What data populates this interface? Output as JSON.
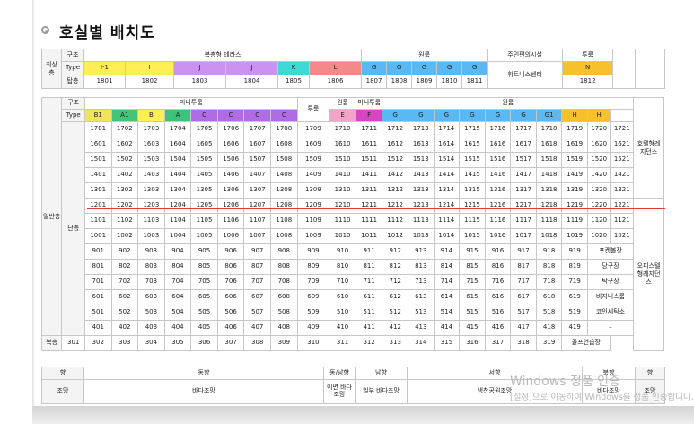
{
  "title": "호실별 배치도",
  "colors": {
    "I": "#ffee55",
    "J": "#c993ef",
    "K": "#3fd8d6",
    "L": "#f28a8a",
    "G": "#5ab8f2",
    "N": "#f7c02d",
    "B1": "#f2e45a",
    "A1": "#44c47b",
    "B": "#ffee55",
    "A": "#3cc27c",
    "C": "#b06ce2",
    "D": "#3aa7e8",
    "E": "#f2a5c8",
    "F": "#d845c0",
    "H": "#f7c02d"
  },
  "top": {
    "side_label": "최상층",
    "row_labels": [
      "구조",
      "Type",
      "탑층"
    ],
    "groups": {
      "bokcheung": "복층형 테라스",
      "wonroom": "원룸",
      "convenience": "주민편의시설",
      "tworoom": "투룸"
    },
    "types": [
      "I-1",
      "I",
      "J",
      "J",
      "K",
      "L",
      "G",
      "G",
      "G",
      "G",
      "G",
      "N"
    ],
    "type_keys": [
      "I",
      "I",
      "J",
      "J",
      "K",
      "L",
      "G",
      "G",
      "G",
      "G",
      "G",
      "N"
    ],
    "units": [
      "1801",
      "1802",
      "1803",
      "1804",
      "1805",
      "1806",
      "1807",
      "1808",
      "1809",
      "1810",
      "1811",
      "1812"
    ],
    "fitness": "휘트니스센터"
  },
  "main": {
    "side_label": "일반층",
    "side_label2": "단층",
    "row_labels": [
      "구조",
      "Type"
    ],
    "groups": {
      "mini": "미니투룸",
      "two": "투룸",
      "one": "원룸",
      "minitwo": "미니투룸",
      "wonroom": "원룸"
    },
    "types": [
      "B1",
      "A1",
      "B",
      "A",
      "C",
      "C",
      "C",
      "C",
      "D",
      "E",
      "F",
      "G",
      "G",
      "G",
      "G",
      "G",
      "G",
      "G1",
      "H",
      "H"
    ],
    "type_keys": [
      "B1",
      "A1",
      "B",
      "A",
      "C",
      "C",
      "C",
      "C",
      "D",
      "E",
      "F",
      "G",
      "G",
      "G",
      "G",
      "G",
      "G",
      "G",
      "H",
      "H"
    ],
    "right_labels": {
      "hotel": "호텔형레지던스",
      "office": "오피스텔형레지던스"
    },
    "rows": [
      [
        "1701",
        "1702",
        "1703",
        "1704",
        "1705",
        "1706",
        "1707",
        "1708",
        "1709",
        "1710",
        "1711",
        "1712",
        "1713",
        "1714",
        "1715",
        "1716",
        "1717",
        "1718",
        "1719",
        "1720",
        "1721"
      ],
      [
        "1601",
        "1602",
        "1603",
        "1604",
        "1605",
        "1606",
        "1607",
        "1608",
        "1609",
        "1610",
        "1611",
        "1612",
        "1613",
        "1614",
        "1615",
        "1616",
        "1617",
        "1618",
        "1619",
        "1620",
        "1621"
      ],
      [
        "1501",
        "1502",
        "1503",
        "1504",
        "1505",
        "1506",
        "1507",
        "1508",
        "1509",
        "1510",
        "1511",
        "1512",
        "1513",
        "1514",
        "1515",
        "1516",
        "1517",
        "1518",
        "1519",
        "1520",
        "1521"
      ],
      [
        "1401",
        "1402",
        "1403",
        "1404",
        "1405",
        "1406",
        "1407",
        "1408",
        "1409",
        "1410",
        "1411",
        "1412",
        "1413",
        "1414",
        "1415",
        "1416",
        "1417",
        "1418",
        "1419",
        "1420",
        "1421"
      ],
      [
        "1301",
        "1302",
        "1303",
        "1304",
        "1305",
        "1306",
        "1307",
        "1308",
        "1309",
        "1310",
        "1311",
        "1312",
        "1313",
        "1314",
        "1315",
        "1316",
        "1317",
        "1318",
        "1319",
        "1320",
        "1321"
      ],
      [
        "1201",
        "1202",
        "1203",
        "1204",
        "1205",
        "1206",
        "1207",
        "1208",
        "1209",
        "1210",
        "1211",
        "1212",
        "1213",
        "1214",
        "1215",
        "1216",
        "1217",
        "1218",
        "1219",
        "1220",
        "1221"
      ],
      [
        "1101",
        "1102",
        "1103",
        "1104",
        "1105",
        "1106",
        "1107",
        "1108",
        "1109",
        "1110",
        "1111",
        "1112",
        "1113",
        "1114",
        "1115",
        "1116",
        "1117",
        "1118",
        "1119",
        "1120",
        "1121"
      ],
      [
        "1001",
        "1002",
        "1003",
        "1004",
        "1005",
        "1006",
        "1007",
        "1008",
        "1009",
        "1010",
        "1011",
        "1012",
        "1013",
        "1014",
        "1015",
        "1016",
        "1017",
        "1018",
        "1019",
        "1020",
        "1021"
      ],
      [
        "901",
        "902",
        "903",
        "904",
        "905",
        "906",
        "907",
        "908",
        "909",
        "910",
        "911",
        "912",
        "913",
        "914",
        "915",
        "916",
        "917",
        "918",
        "919",
        "포켓볼장"
      ],
      [
        "801",
        "802",
        "803",
        "804",
        "805",
        "806",
        "807",
        "808",
        "809",
        "810",
        "811",
        "812",
        "813",
        "814",
        "815",
        "816",
        "817",
        "818",
        "819",
        "당구장"
      ],
      [
        "701",
        "702",
        "703",
        "704",
        "705",
        "706",
        "707",
        "708",
        "709",
        "710",
        "711",
        "712",
        "713",
        "714",
        "715",
        "716",
        "717",
        "718",
        "719",
        "탁구장"
      ],
      [
        "601",
        "602",
        "603",
        "604",
        "605",
        "606",
        "607",
        "608",
        "609",
        "610",
        "611",
        "612",
        "613",
        "614",
        "615",
        "616",
        "617",
        "618",
        "619",
        "비지니스룸"
      ],
      [
        "501",
        "502",
        "503",
        "504",
        "505",
        "506",
        "507",
        "508",
        "509",
        "510",
        "511",
        "512",
        "513",
        "514",
        "515",
        "516",
        "517",
        "518",
        "519",
        "코인세탁소"
      ],
      [
        "401",
        "402",
        "403",
        "404",
        "405",
        "406",
        "407",
        "408",
        "409",
        "410",
        "411",
        "412",
        "413",
        "414",
        "415",
        "416",
        "417",
        "418",
        "419",
        "–"
      ]
    ],
    "bokcheung_label": "복층",
    "bokcheung_row": [
      "301",
      "302",
      "303",
      "304",
      "305",
      "306",
      "307",
      "308",
      "309",
      "310",
      "311",
      "312",
      "313",
      "314",
      "315",
      "316",
      "317",
      "318",
      "319",
      "골프연습장"
    ]
  },
  "bottom": {
    "orientation_label": "향",
    "view_label": "조망",
    "orientation": [
      "동향",
      "동/남향",
      "남향",
      "서향",
      "북향"
    ],
    "views": [
      "바다조망",
      "이면 바다조망",
      "일부 바다조망",
      "냉천공원조망",
      "바다조망"
    ]
  },
  "watermark": {
    "title": "Windows 정품 인증",
    "sub": "[설정]으로 이동하여 Windows를 정품 인증합니다."
  }
}
